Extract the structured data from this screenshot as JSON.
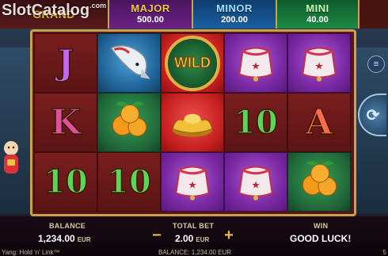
{
  "watermark": {
    "text": "SlotCatalog",
    "suffix": ".com"
  },
  "jackpots": {
    "grand": {
      "name": "GRAND",
      "value": ""
    },
    "major": {
      "name": "MAJOR",
      "value": "500.00"
    },
    "minor": {
      "name": "MINOR",
      "value": "200.00"
    },
    "mini": {
      "name": "MINI",
      "value": "40.00"
    }
  },
  "reels": [
    [
      {
        "symbol": "J",
        "kind": "letter"
      },
      {
        "symbol": "K",
        "kind": "letter"
      },
      {
        "symbol": "10",
        "kind": "letter"
      }
    ],
    [
      {
        "symbol": "koi-fish",
        "kind": "icon"
      },
      {
        "symbol": "oranges",
        "kind": "icon"
      },
      {
        "symbol": "10",
        "kind": "letter"
      }
    ],
    [
      {
        "symbol": "WILD",
        "kind": "wild"
      },
      {
        "symbol": "gold-ingot",
        "kind": "icon"
      },
      {
        "symbol": "lucky-bag",
        "kind": "icon"
      }
    ],
    [
      {
        "symbol": "lucky-bag",
        "kind": "icon"
      },
      {
        "symbol": "10",
        "kind": "letter"
      },
      {
        "symbol": "lucky-bag",
        "kind": "icon"
      }
    ],
    [
      {
        "symbol": "lucky-bag",
        "kind": "icon"
      },
      {
        "symbol": "A",
        "kind": "letter"
      },
      {
        "symbol": "oranges",
        "kind": "icon"
      }
    ]
  ],
  "hud": {
    "balance_label": "BALANCE",
    "balance_value": "1,234.00",
    "balance_unit": "EUR",
    "total_bet_label": "TOTAL BET",
    "total_bet_value": "2.00",
    "total_bet_unit": "EUR",
    "win_label": "WIN",
    "win_value": "GOOD LUCK!",
    "minus": "−",
    "plus": "+"
  },
  "footer": {
    "game_name": "Yang: Hold 'n' Link™",
    "balance_text": "BALANCE: 1,234.00 EUR",
    "right_text": "5"
  },
  "colors": {
    "frame_gold": "#c9a24a",
    "reel_red": "#5b1414",
    "accent_gold": "#e8b94a"
  }
}
